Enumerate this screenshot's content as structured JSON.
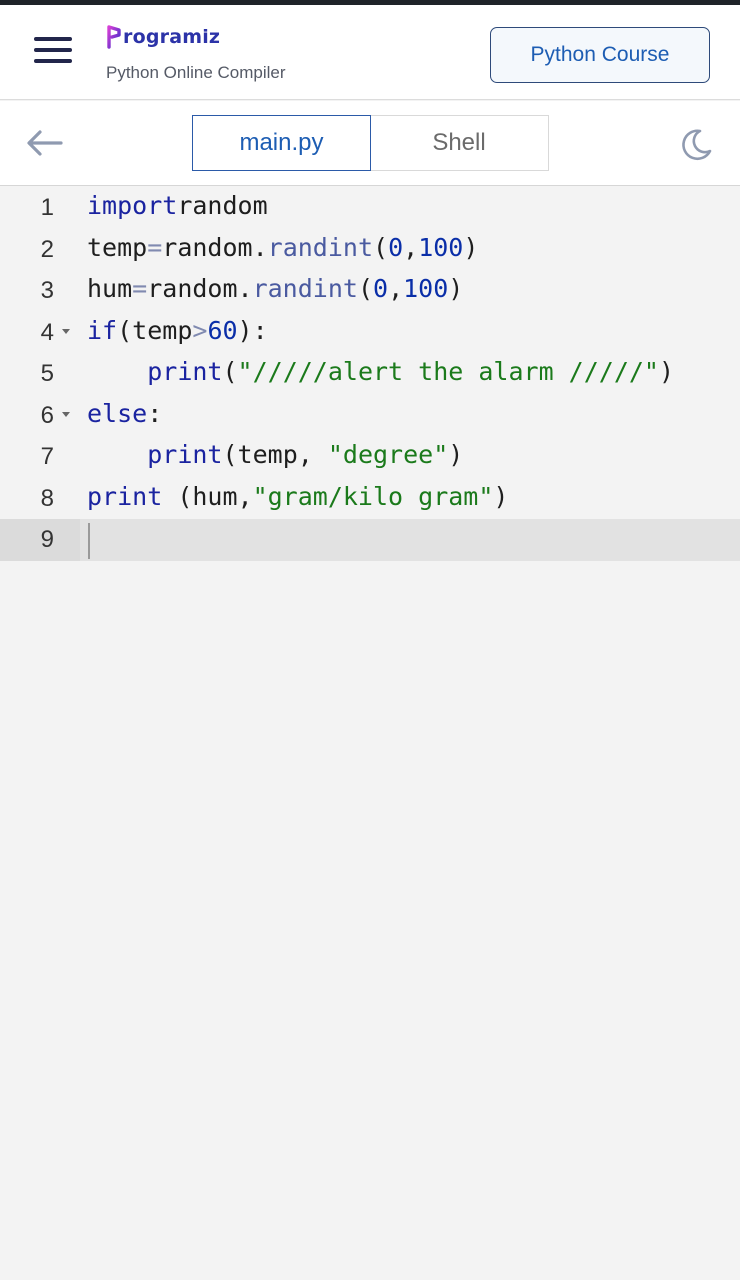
{
  "header": {
    "menu_icon": "hamburger-icon",
    "brand_name": "rogramiz",
    "subtitle": "Python Online Compiler",
    "course_button": "Python Course"
  },
  "toolbar": {
    "back_icon": "arrow-left-icon",
    "tabs": [
      {
        "label": "main.py",
        "active": true
      },
      {
        "label": "Shell",
        "active": false
      }
    ],
    "theme_icon": "moon-icon"
  },
  "editor": {
    "lines": [
      {
        "number": "1",
        "foldable": false
      },
      {
        "number": "2",
        "foldable": false
      },
      {
        "number": "3",
        "foldable": false
      },
      {
        "number": "4",
        "foldable": true
      },
      {
        "number": "5",
        "foldable": false
      },
      {
        "number": "6",
        "foldable": true
      },
      {
        "number": "7",
        "foldable": false
      },
      {
        "number": "8",
        "foldable": false
      },
      {
        "number": "9",
        "foldable": false
      }
    ],
    "code": [
      [
        [
          "kw",
          "import"
        ],
        [
          "",
          "random"
        ]
      ],
      [
        [
          "",
          "temp"
        ],
        [
          "op",
          "="
        ],
        [
          "",
          "random."
        ],
        [
          "fn",
          "randint"
        ],
        [
          "",
          "("
        ],
        [
          "num",
          "0"
        ],
        [
          "",
          ","
        ],
        [
          "num",
          "100"
        ],
        [
          "",
          ")"
        ]
      ],
      [
        [
          "",
          "hum"
        ],
        [
          "op",
          "="
        ],
        [
          "",
          "random."
        ],
        [
          "fn",
          "randint"
        ],
        [
          "",
          "("
        ],
        [
          "num",
          "0"
        ],
        [
          "",
          ","
        ],
        [
          "num",
          "100"
        ],
        [
          "",
          ")"
        ]
      ],
      [
        [
          "kw",
          "if"
        ],
        [
          "",
          "(temp"
        ],
        [
          "op",
          ">"
        ],
        [
          "num",
          "60"
        ],
        [
          "",
          "):"
        ]
      ],
      [
        [
          "",
          "    "
        ],
        [
          "kw",
          "print"
        ],
        [
          "",
          "("
        ],
        [
          "str",
          "\"/////alert the alarm /////\""
        ],
        [
          "",
          ")"
        ]
      ],
      [
        [
          "kw",
          "else"
        ],
        [
          "",
          ":"
        ]
      ],
      [
        [
          "",
          "    "
        ],
        [
          "kw",
          "print"
        ],
        [
          "",
          "(temp, "
        ],
        [
          "str",
          "\"degree\""
        ],
        [
          "",
          ")"
        ]
      ],
      [
        [
          "kw",
          "print"
        ],
        [
          "",
          " (hum,"
        ],
        [
          "str",
          "\"gram/kilo gram\""
        ],
        [
          "",
          ")"
        ]
      ],
      []
    ],
    "active_line": 9,
    "colors": {
      "keyword": "#1a23a0",
      "string": "#1b7a1b",
      "number": "#0a2ea8",
      "function": "#4a5aa0"
    }
  }
}
